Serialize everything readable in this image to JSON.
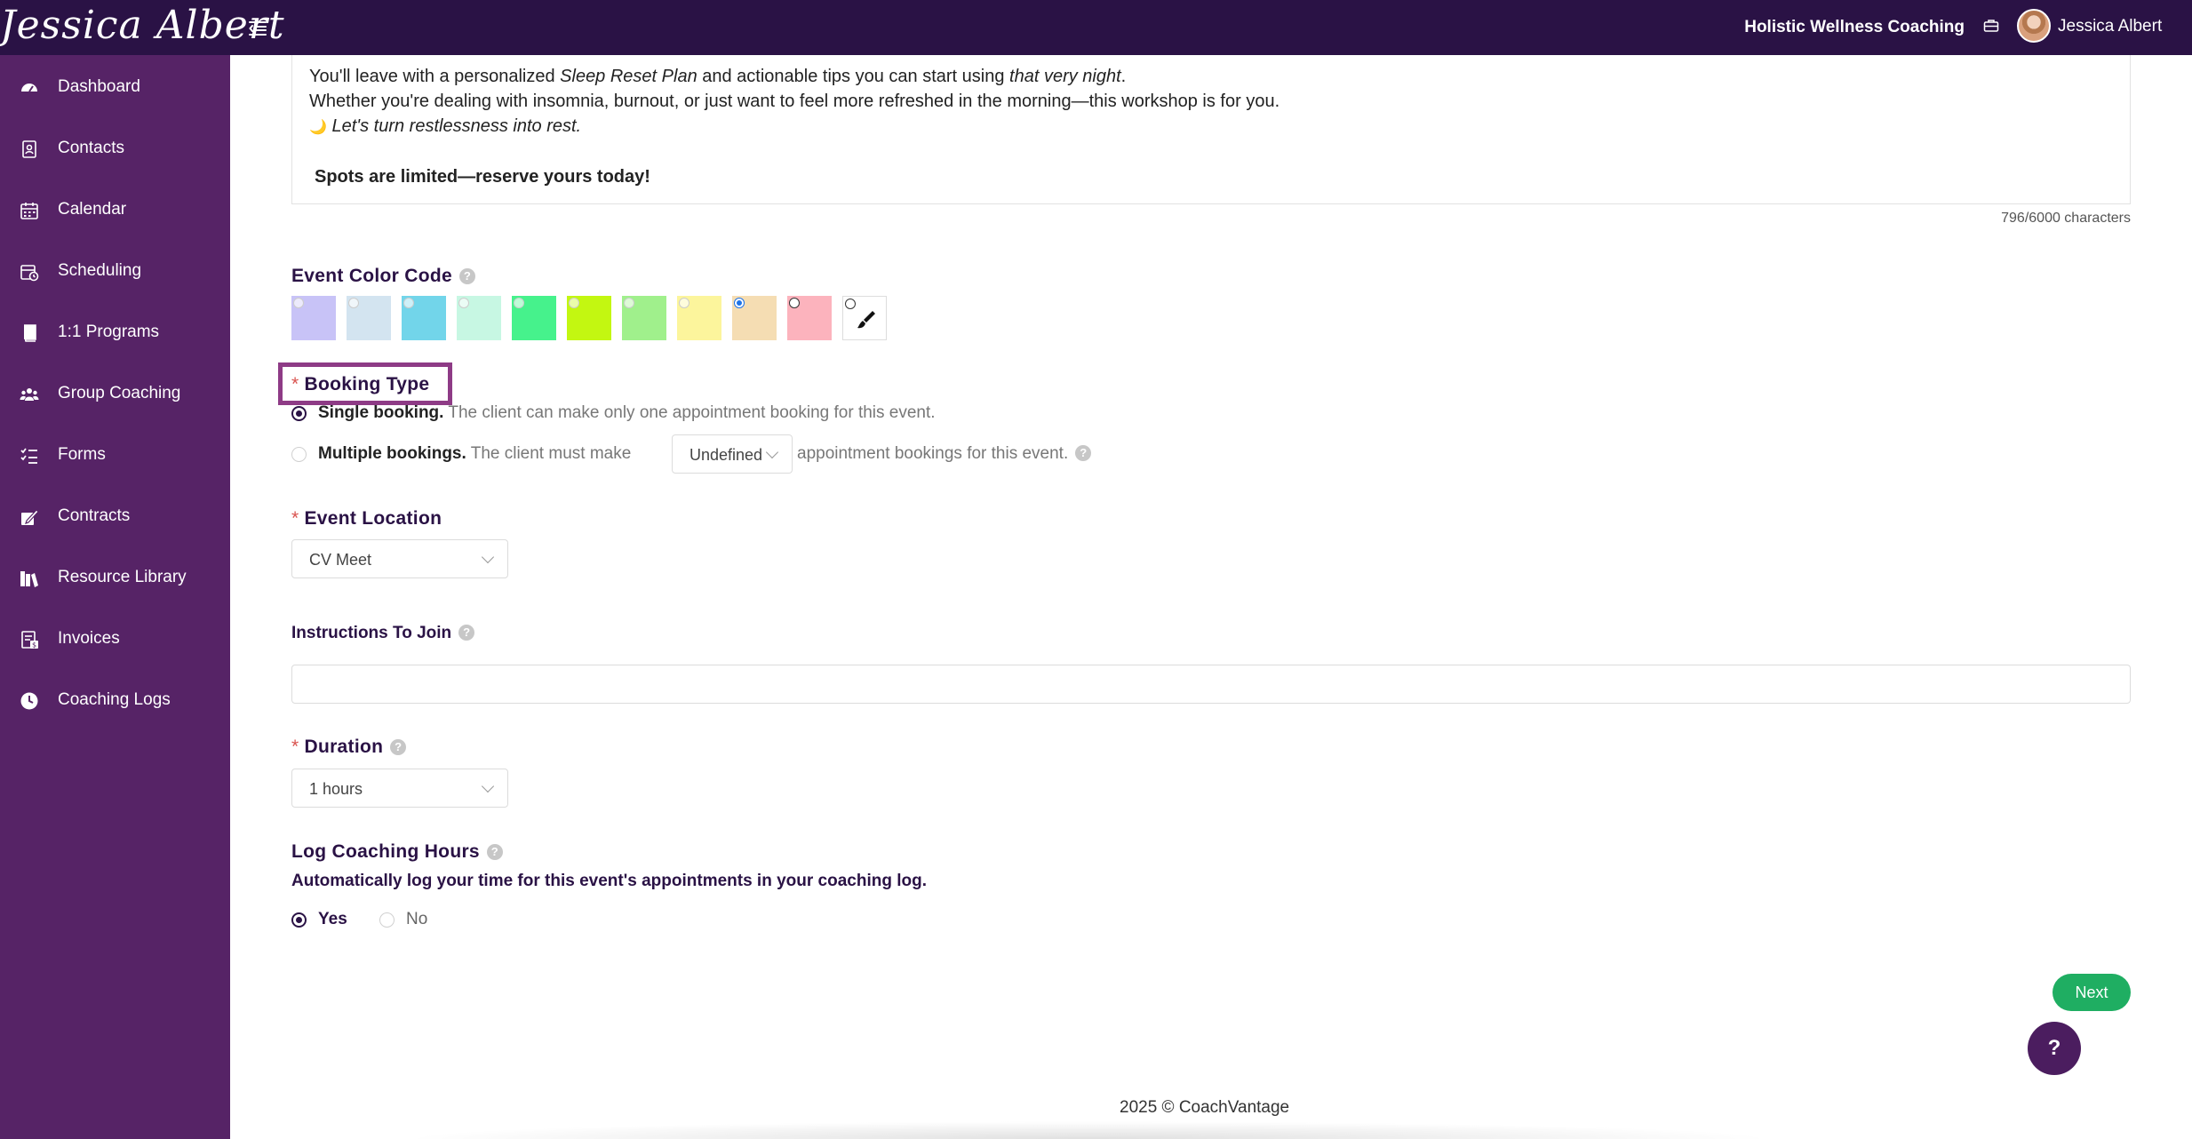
{
  "app": {
    "brand": "Jessica Albert",
    "workspace": "Holistic Wellness Coaching",
    "user_name": "Jessica Albert"
  },
  "sidebar": {
    "items": [
      {
        "label": "Dashboard",
        "icon": "dashboard-icon"
      },
      {
        "label": "Contacts",
        "icon": "contacts-icon"
      },
      {
        "label": "Calendar",
        "icon": "calendar-icon"
      },
      {
        "label": "Scheduling",
        "icon": "scheduling-icon"
      },
      {
        "label": "1:1 Programs",
        "icon": "book-icon"
      },
      {
        "label": "Group Coaching",
        "icon": "group-icon"
      },
      {
        "label": "Forms",
        "icon": "forms-icon"
      },
      {
        "label": "Contracts",
        "icon": "contract-icon"
      },
      {
        "label": "Resource Library",
        "icon": "library-icon"
      },
      {
        "label": "Invoices",
        "icon": "invoice-icon"
      },
      {
        "label": "Coaching Logs",
        "icon": "clock-icon"
      }
    ]
  },
  "description": {
    "line1_a": "You'll leave with a personalized ",
    "line1_b": "Sleep Reset Plan",
    "line1_c": " and actionable tips you can start using ",
    "line1_d": "that very night",
    "line1_e": ".",
    "line2": "Whether you're dealing with insomnia, burnout, or just want to feel more refreshed in the morning—this workshop is for you.",
    "line3_emoji": "🌙",
    "line3": "Let's turn restlessness into rest.",
    "line4": "Spots are limited—reserve yours today!",
    "char_count": "796/6000 characters"
  },
  "event_color": {
    "label": "Event Color Code",
    "swatches": [
      "#c8c3f7",
      "#d3e4f0",
      "#72d5ea",
      "#c7f7e3",
      "#46f28c",
      "#c3f711",
      "#a0f08c",
      "#fcf59c",
      "#f5ddb3",
      "#fcb3bd"
    ],
    "selected_index": 8
  },
  "booking_type": {
    "label": "Booking Type",
    "single_strong": "Single booking.",
    "single_desc": " The client can make only one appointment booking for this event.",
    "multiple_strong": "Multiple bookings.",
    "multiple_desc_a": " The client must make",
    "multiple_select": "Undefined",
    "multiple_desc_b": "appointment bookings for this event.",
    "selected": "single"
  },
  "event_location": {
    "label": "Event Location",
    "value": "CV Meet"
  },
  "instructions": {
    "label": "Instructions To Join",
    "value": ""
  },
  "duration": {
    "label": "Duration",
    "value": "1 hours"
  },
  "log_hours": {
    "label": "Log Coaching Hours",
    "caption": "Automatically log your time for this event's appointments in your coaching log.",
    "yes": "Yes",
    "no": "No",
    "selected": "yes"
  },
  "actions": {
    "next": "Next",
    "help": "?"
  },
  "footer": "2025 © CoachVantage"
}
